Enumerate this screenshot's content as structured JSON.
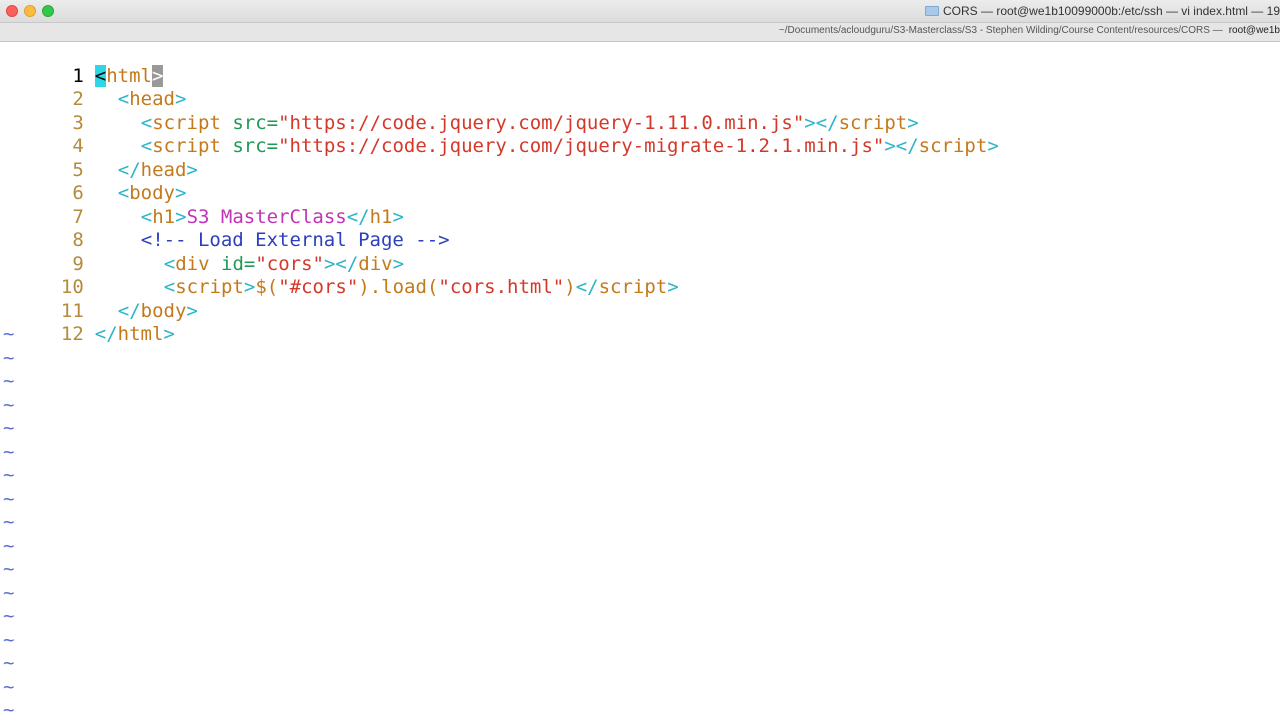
{
  "window": {
    "title": "CORS — root@we1b10099000b:/etc/ssh — vi index.html — 19",
    "path": "~/Documents/acloudguru/S3-Masterclass/S3 - Stephen Wilding/Course Content/resources/CORS —",
    "active_tab": "root@we1b"
  },
  "editor": {
    "line_numbers": [
      "1",
      "2",
      "3",
      "4",
      "5",
      "6",
      "7",
      "8",
      "9",
      "10",
      "11",
      "12"
    ],
    "l1": {
      "o": "<",
      "tag": "html",
      "c": ">"
    },
    "l2": {
      "o": "<",
      "tag": "head",
      "c": ">"
    },
    "l3": {
      "o": "<",
      "tag": "script",
      "sp": " ",
      "attr": "src=",
      "val": "\"https://code.jquery.com/jquery-1.11.0.min.js\"",
      "c": "></",
      "ctag": "script",
      "cc": ">"
    },
    "l4": {
      "o": "<",
      "tag": "script",
      "sp": " ",
      "attr": "src=",
      "val": "\"https://code.jquery.com/jquery-migrate-1.2.1.min.js\"",
      "c": "></",
      "ctag": "script",
      "cc": ">"
    },
    "l5": {
      "o": "</",
      "tag": "head",
      "c": ">"
    },
    "l6": {
      "o": "<",
      "tag": "body",
      "c": ">"
    },
    "l7": {
      "o": "<",
      "tag": "h1",
      "c": ">",
      "text": "S3 MasterClass",
      "o2": "</",
      "ctag": "h1",
      "cc": ">"
    },
    "l8": {
      "comment": "<!-- Load External Page -->"
    },
    "l9": {
      "o": "<",
      "tag": "div",
      "sp": " ",
      "attr": "id=",
      "val": "\"cors\"",
      "c": "></",
      "ctag": "div",
      "cc": ">"
    },
    "l10": {
      "o": "<",
      "tag": "script",
      "c": ">",
      "js1": "$(",
      "str1": "\"#cors\"",
      "js2": ").",
      "fn": "load",
      "js3": "(",
      "str2": "\"cors.html\"",
      "js4": ")",
      "o2": "</",
      "ctag": "script",
      "cc": ">"
    },
    "l11": {
      "o": "</",
      "tag": "body",
      "c": ">"
    },
    "l12": {
      "o": "</",
      "tag": "html",
      "c": ">"
    },
    "tilde": "~"
  },
  "colors": {
    "accent_cursor": "#2cd8e6",
    "tilde": "#5a6fd6"
  }
}
